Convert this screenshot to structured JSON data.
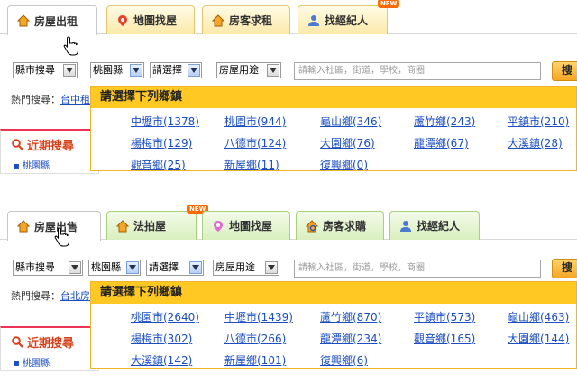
{
  "top": {
    "tabs": [
      {
        "label": "房屋出租",
        "icon": "house-icon"
      },
      {
        "label": "地圖找屋",
        "icon": "map-pin-icon"
      },
      {
        "label": "房客求租",
        "icon": "house-icon"
      },
      {
        "label": "找經紀人",
        "icon": "agent-icon",
        "badge": "NEW"
      }
    ],
    "search": {
      "county_select": "縣市搜尋",
      "county_value": "桃園縣",
      "district_value": "請選擇",
      "usage_select": "房屋用途",
      "placeholder": "請輸入社區，街道，學校，商圈",
      "button_label": "搜"
    },
    "hot_label": "熱門搜尋：",
    "hot_link": "台中租",
    "recent_title": "近期搜尋",
    "recent_item": "桃園縣",
    "dropdown": {
      "heading": "請選擇下列鄉鎮",
      "towns": [
        "中壢市(1378)",
        "桃園市(944)",
        "龜山鄉(346)",
        "蘆竹鄉(243)",
        "平鎮市(210)",
        "楊梅市(129)",
        "八德市(124)",
        "大園鄉(76)",
        "龍潭鄉(67)",
        "大溪鎮(28)",
        "觀音鄉(25)",
        "新屋鄉(11)",
        "復興鄉(0)"
      ]
    }
  },
  "bottom": {
    "tabs": [
      {
        "label": "房屋出售",
        "icon": "house-icon"
      },
      {
        "label": "法拍屋",
        "icon": "house-icon",
        "badge": "NEW"
      },
      {
        "label": "地圖找屋",
        "icon": "map-pin-icon"
      },
      {
        "label": "房客求購",
        "icon": "house-search-icon"
      },
      {
        "label": "找經紀人",
        "icon": "agent-icon"
      }
    ],
    "search": {
      "county_select": "縣市搜尋",
      "county_value": "桃園縣",
      "district_value": "請選擇",
      "usage_select": "房屋用途",
      "placeholder": "請輸入社區，街道，學校，商圈",
      "button_label": "搜"
    },
    "hot_label": "熱門搜尋：",
    "hot_link": "台北房",
    "recent_title": "近期搜尋",
    "recent_item": "桃園縣",
    "dropdown": {
      "heading": "請選擇下列鄉鎮",
      "towns": [
        "桃園市(2640)",
        "中壢市(1439)",
        "蘆竹鄉(870)",
        "平鎮市(573)",
        "龜山鄉(463)",
        "楊梅市(302)",
        "八德市(266)",
        "龍潭鄉(234)",
        "觀音鄉(165)",
        "大園鄉(144)",
        "大溪鎮(142)",
        "新屋鄉(101)",
        "復興鄉(6)"
      ]
    }
  },
  "colors": {
    "accent": "#ffc823",
    "link": "#1b4ec2",
    "recent": "#d8401a"
  }
}
